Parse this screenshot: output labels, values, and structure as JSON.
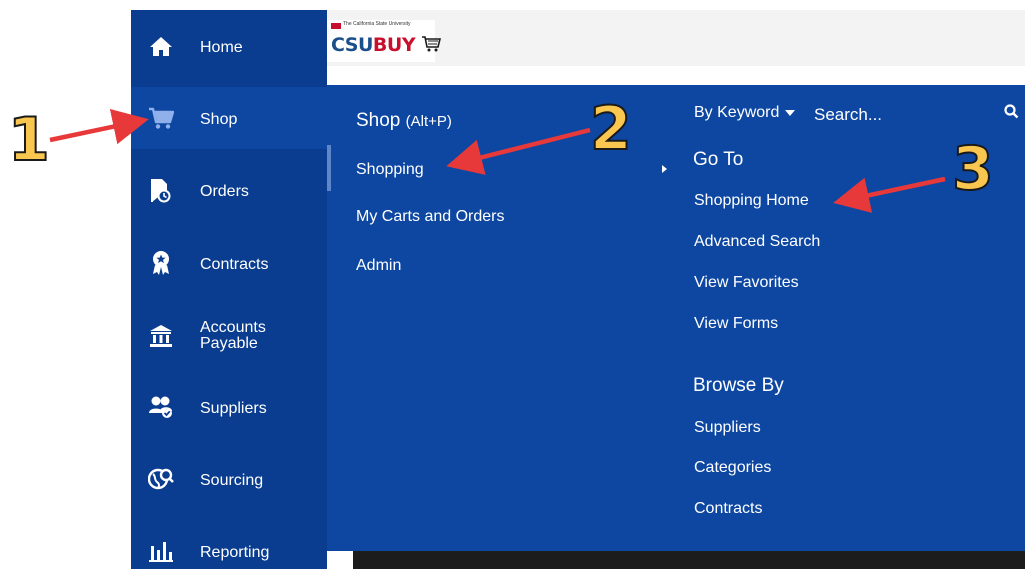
{
  "logo": {
    "small_text": "The California State University",
    "brand_a": "CSU",
    "brand_b": "BUY"
  },
  "sidebar": {
    "items": [
      {
        "label": "Home",
        "icon": "home-icon"
      },
      {
        "label": "Shop",
        "icon": "cart-icon",
        "active": true
      },
      {
        "label": "Orders",
        "icon": "orders-icon"
      },
      {
        "label": "Contracts",
        "icon": "contract-badge-icon"
      },
      {
        "label": "Accounts Payable",
        "icon": "bank-icon"
      },
      {
        "label": "Suppliers",
        "icon": "suppliers-icon"
      },
      {
        "label": "Sourcing",
        "icon": "sourcing-icon"
      },
      {
        "label": "Reporting",
        "icon": "bar-chart-icon"
      }
    ]
  },
  "flyout": {
    "title": "Shop",
    "shortcut": "(Alt+P)",
    "items": [
      "Shopping",
      "My Carts and Orders",
      "Admin"
    ],
    "search_mode": "By Keyword",
    "search_placeholder": "Search...",
    "goto_heading": "Go To",
    "goto_links": [
      "Shopping Home",
      "Advanced Search",
      "View Favorites",
      "View Forms"
    ],
    "browse_heading": "Browse By",
    "browse_links": [
      "Suppliers",
      "Categories",
      "Contracts"
    ]
  },
  "annotations": {
    "numbers": [
      "1",
      "2",
      "3"
    ]
  },
  "colors": {
    "nav_bg": "#0a3c8f",
    "flyout_bg": "#0d47a1",
    "arrow": "#e8393a",
    "callout_number": "#f9c74f"
  }
}
